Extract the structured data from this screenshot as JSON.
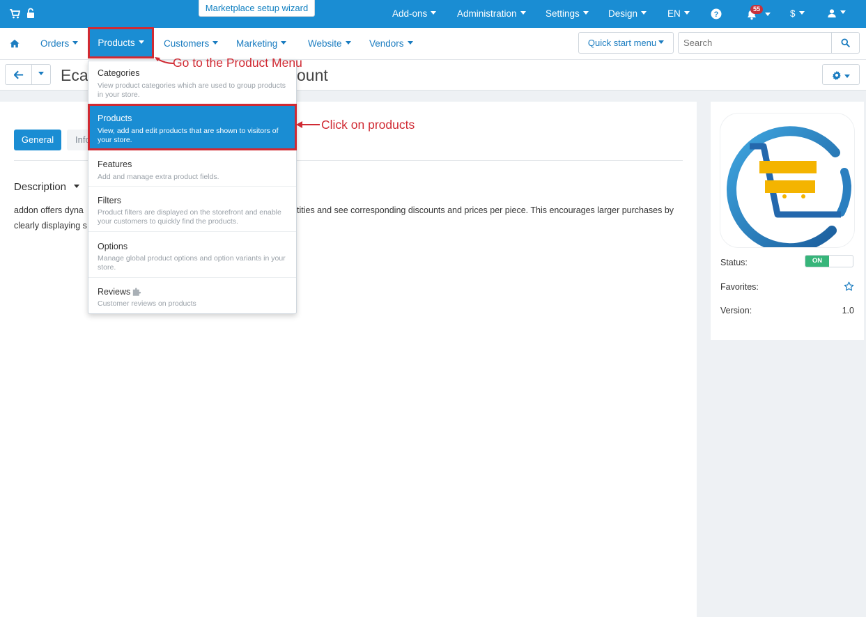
{
  "topbar": {
    "wizard_label": "Marketplace setup wizard",
    "items": [
      {
        "label": "Add-ons"
      },
      {
        "label": "Administration"
      },
      {
        "label": "Settings"
      },
      {
        "label": "Design"
      },
      {
        "label": "EN"
      }
    ],
    "notification_count": "55",
    "currency": "$",
    "bar_color": "#1a8dd3"
  },
  "nav": {
    "items": [
      {
        "label": "Orders"
      },
      {
        "label": "Products"
      },
      {
        "label": "Customers"
      },
      {
        "label": "Marketing"
      },
      {
        "label": "Website"
      },
      {
        "label": "Vendors"
      }
    ],
    "quick_start": "Quick start menu",
    "search_placeholder": "Search"
  },
  "toolbar": {
    "title_left": "Eca",
    "title_right": "ount"
  },
  "tabs": {
    "general": "General",
    "info": "Info"
  },
  "description": {
    "heading": "Description",
    "line1_left": "addon offers dyna",
    "line1_right": "tities and see corresponding discounts and prices per piece. This encourages larger purchases by",
    "line2_left": "clearly displaying s"
  },
  "dropdown": {
    "items": [
      {
        "title": "Categories",
        "desc": "View product categories which are used to group products in your store."
      },
      {
        "title": "Products",
        "desc": "View, add and edit products that are shown to visitors of your store."
      },
      {
        "title": "Features",
        "desc": "Add and manage extra product fields."
      },
      {
        "title": "Filters",
        "desc": "Product filters are displayed on the storefront and enable your customers to quickly find the products."
      },
      {
        "title": "Options",
        "desc": "Manage global product options and option variants in your store."
      },
      {
        "title": "Reviews",
        "desc": "Customer reviews on products"
      }
    ]
  },
  "sidebar": {
    "status_label": "Status:",
    "status_value": "ON",
    "favorites_label": "Favorites:",
    "version_label": "Version:",
    "version_value": "1.0"
  },
  "annotations": {
    "menu_note": "Go to the Product Menu",
    "products_note": "Click on products",
    "color": "#d02a33"
  }
}
